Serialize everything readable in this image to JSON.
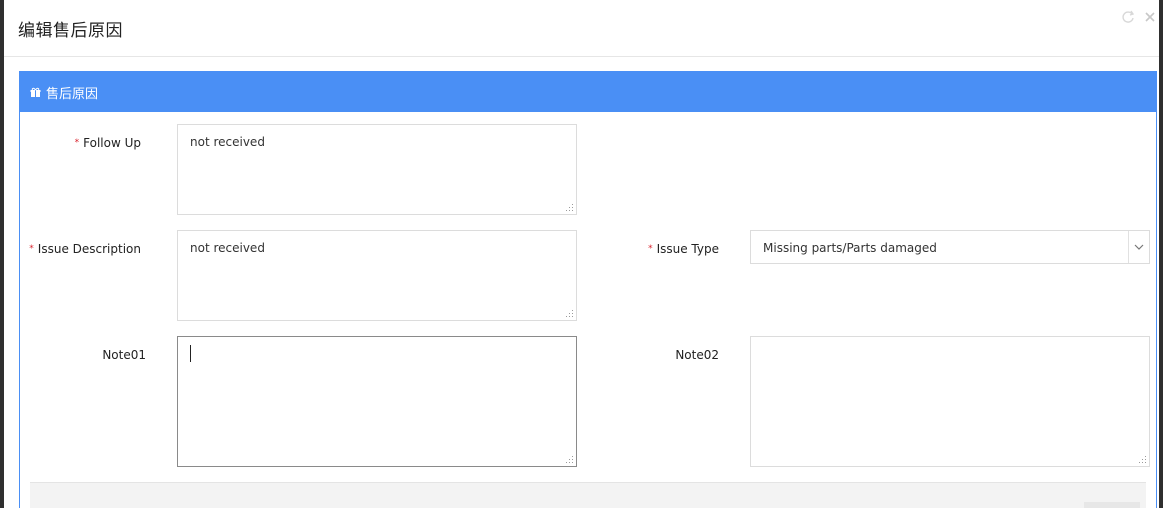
{
  "modal": {
    "title": "编辑售后原因"
  },
  "panel": {
    "heading": "售后原因",
    "heading_icon": "gift-icon"
  },
  "form": {
    "follow_up": {
      "label": "Follow Up",
      "required": true,
      "value": "not received"
    },
    "issue_description": {
      "label": "Issue Description",
      "required": true,
      "value": "not received"
    },
    "issue_type": {
      "label": "Issue Type",
      "required": true,
      "selected": "Missing parts/Parts damaged"
    },
    "note01": {
      "label": "Note01",
      "value": ""
    },
    "note02": {
      "label": "Note02",
      "value": ""
    }
  },
  "colors": {
    "panel_header_bg": "#4a8ff5",
    "required_star": "#d9232d",
    "modal_bg": "#ffffff",
    "backdrop": "#2f2f2f"
  },
  "icons": {
    "refresh": "refresh-icon",
    "close": "close-icon",
    "select_arrow": "chevron-down-icon"
  }
}
